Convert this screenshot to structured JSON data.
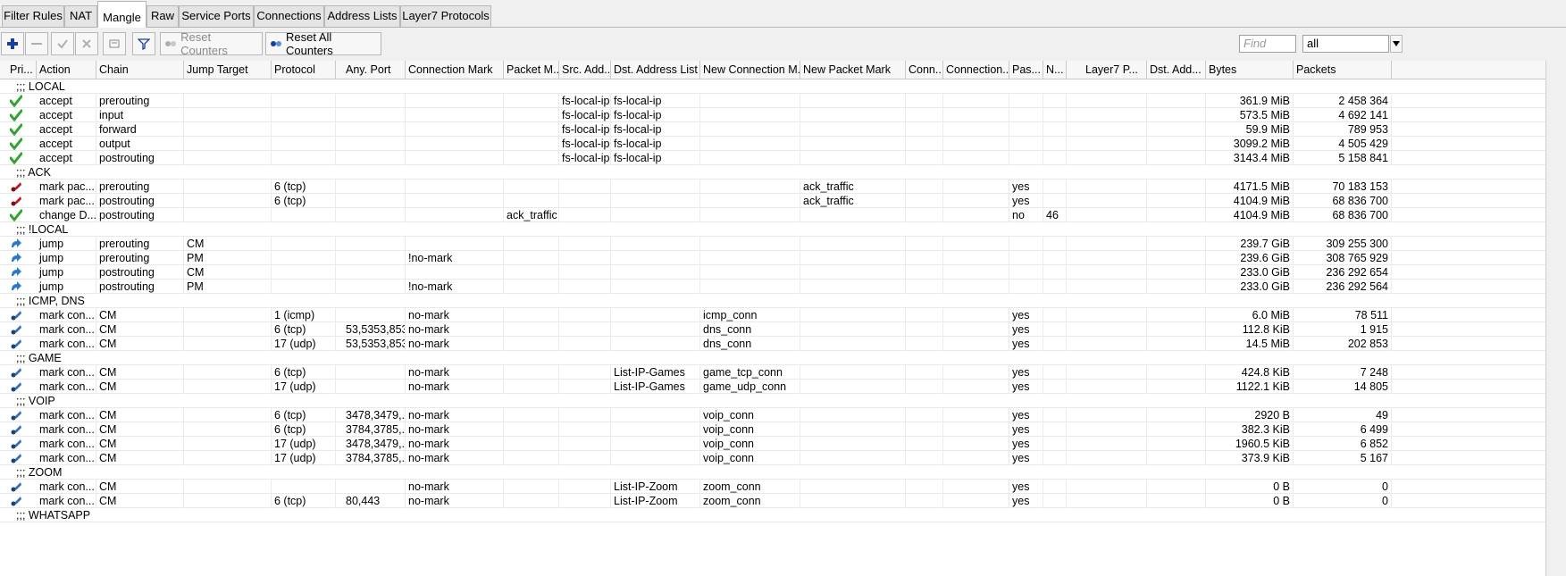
{
  "tabs": [
    "Filter Rules",
    "NAT",
    "Mangle",
    "Raw",
    "Service Ports",
    "Connections",
    "Address Lists",
    "Layer7 Protocols"
  ],
  "toolbar": {
    "reset_counters": "Reset Counters",
    "reset_all_counters": "Reset All Counters",
    "find_placeholder": "Find",
    "filter_value": "all"
  },
  "columns": [
    "Pri...",
    "Action",
    "Chain",
    "Jump Target",
    "Protocol",
    "Any. Port",
    "Connection Mark",
    "Packet M...",
    "Src. Add...",
    "Dst. Address List",
    "New Connection M...",
    "New Packet Mark",
    "Conn...",
    "Connection...",
    "Pas...",
    "N...",
    "Layer7 P...",
    "Dst. Add...",
    "Bytes",
    "Packets"
  ],
  "rows": [
    {
      "comment": ";;; LOCAL"
    },
    {
      "icon": "accept-icon",
      "action": "accept",
      "chain": "prerouting",
      "jump": "",
      "proto": "",
      "port": "",
      "cmark": "",
      "pmark": "",
      "src": "fs-local-ip",
      "dst": "fs-local-ip",
      "ncm": "",
      "npm": "",
      "pass": "",
      "n": "",
      "bytes": "361.9 MiB",
      "packets": "2 458 364"
    },
    {
      "icon": "accept-icon",
      "action": "accept",
      "chain": "input",
      "jump": "",
      "proto": "",
      "port": "",
      "cmark": "",
      "pmark": "",
      "src": "fs-local-ip",
      "dst": "fs-local-ip",
      "ncm": "",
      "npm": "",
      "pass": "",
      "n": "",
      "bytes": "573.5 MiB",
      "packets": "4 692 141"
    },
    {
      "icon": "accept-icon",
      "action": "accept",
      "chain": "forward",
      "jump": "",
      "proto": "",
      "port": "",
      "cmark": "",
      "pmark": "",
      "src": "fs-local-ip",
      "dst": "fs-local-ip",
      "ncm": "",
      "npm": "",
      "pass": "",
      "n": "",
      "bytes": "59.9 MiB",
      "packets": "789 953"
    },
    {
      "icon": "accept-icon",
      "action": "accept",
      "chain": "output",
      "jump": "",
      "proto": "",
      "port": "",
      "cmark": "",
      "pmark": "",
      "src": "fs-local-ip",
      "dst": "fs-local-ip",
      "ncm": "",
      "npm": "",
      "pass": "",
      "n": "",
      "bytes": "3099.2 MiB",
      "packets": "4 505 429"
    },
    {
      "icon": "accept-icon",
      "action": "accept",
      "chain": "postrouting",
      "jump": "",
      "proto": "",
      "port": "",
      "cmark": "",
      "pmark": "",
      "src": "fs-local-ip",
      "dst": "fs-local-ip",
      "ncm": "",
      "npm": "",
      "pass": "",
      "n": "",
      "bytes": "3143.4 MiB",
      "packets": "5 158 841"
    },
    {
      "comment": ";;; ACK"
    },
    {
      "icon": "mark-packet-icon",
      "action": "mark pac...",
      "chain": "prerouting",
      "jump": "",
      "proto": "6 (tcp)",
      "port": "",
      "cmark": "",
      "pmark": "",
      "src": "",
      "dst": "",
      "ncm": "",
      "npm": "ack_traffic",
      "pass": "yes",
      "n": "",
      "bytes": "4171.5 MiB",
      "packets": "70 183 153"
    },
    {
      "icon": "mark-packet-icon",
      "action": "mark pac...",
      "chain": "postrouting",
      "jump": "",
      "proto": "6 (tcp)",
      "port": "",
      "cmark": "",
      "pmark": "",
      "src": "",
      "dst": "",
      "ncm": "",
      "npm": "ack_traffic",
      "pass": "yes",
      "n": "",
      "bytes": "4104.9 MiB",
      "packets": "68 836 700"
    },
    {
      "icon": "accept-icon",
      "action": "change D...",
      "chain": "postrouting",
      "jump": "",
      "proto": "",
      "port": "",
      "cmark": "",
      "pmark": "ack_traffic",
      "src": "",
      "dst": "",
      "ncm": "",
      "npm": "",
      "pass": "no",
      "n": "46",
      "bytes": "4104.9 MiB",
      "packets": "68 836 700"
    },
    {
      "comment": ";;; !LOCAL"
    },
    {
      "icon": "jump-icon",
      "action": "jump",
      "chain": "prerouting",
      "jump": "CM",
      "proto": "",
      "port": "",
      "cmark": "",
      "pmark": "",
      "src": "",
      "dst": "",
      "ncm": "",
      "npm": "",
      "pass": "",
      "n": "",
      "bytes": "239.7 GiB",
      "packets": "309 255 300"
    },
    {
      "icon": "jump-icon",
      "action": "jump",
      "chain": "prerouting",
      "jump": "PM",
      "proto": "",
      "port": "",
      "cmark": "!no-mark",
      "pmark": "",
      "src": "",
      "dst": "",
      "ncm": "",
      "npm": "",
      "pass": "",
      "n": "",
      "bytes": "239.6 GiB",
      "packets": "308 765 929"
    },
    {
      "icon": "jump-icon",
      "action": "jump",
      "chain": "postrouting",
      "jump": "CM",
      "proto": "",
      "port": "",
      "cmark": "",
      "pmark": "",
      "src": "",
      "dst": "",
      "ncm": "",
      "npm": "",
      "pass": "",
      "n": "",
      "bytes": "233.0 GiB",
      "packets": "236 292 654"
    },
    {
      "icon": "jump-icon",
      "action": "jump",
      "chain": "postrouting",
      "jump": "PM",
      "proto": "",
      "port": "",
      "cmark": "!no-mark",
      "pmark": "",
      "src": "",
      "dst": "",
      "ncm": "",
      "npm": "",
      "pass": "",
      "n": "",
      "bytes": "233.0 GiB",
      "packets": "236 292 564"
    },
    {
      "comment": ";;; ICMP, DNS"
    },
    {
      "icon": "mark-connection-icon",
      "action": "mark con...",
      "chain": "CM",
      "jump": "",
      "proto": "1 (icmp)",
      "port": "",
      "cmark": "no-mark",
      "pmark": "",
      "src": "",
      "dst": "",
      "ncm": "icmp_conn",
      "npm": "",
      "pass": "yes",
      "n": "",
      "bytes": "6.0 MiB",
      "packets": "78 511"
    },
    {
      "icon": "mark-connection-icon",
      "action": "mark con...",
      "chain": "CM",
      "jump": "",
      "proto": "6 (tcp)",
      "port": "53,5353,853",
      "cmark": "no-mark",
      "pmark": "",
      "src": "",
      "dst": "",
      "ncm": "dns_conn",
      "npm": "",
      "pass": "yes",
      "n": "",
      "bytes": "112.8 KiB",
      "packets": "1 915"
    },
    {
      "icon": "mark-connection-icon",
      "action": "mark con...",
      "chain": "CM",
      "jump": "",
      "proto": "17 (udp)",
      "port": "53,5353,853",
      "cmark": "no-mark",
      "pmark": "",
      "src": "",
      "dst": "",
      "ncm": "dns_conn",
      "npm": "",
      "pass": "yes",
      "n": "",
      "bytes": "14.5 MiB",
      "packets": "202 853"
    },
    {
      "comment": ";;; GAME"
    },
    {
      "icon": "mark-connection-icon",
      "action": "mark con...",
      "chain": "CM",
      "jump": "",
      "proto": "6 (tcp)",
      "port": "",
      "cmark": "no-mark",
      "pmark": "",
      "src": "",
      "dst": "List-IP-Games",
      "ncm": "game_tcp_conn",
      "npm": "",
      "pass": "yes",
      "n": "",
      "bytes": "424.8 KiB",
      "packets": "7 248"
    },
    {
      "icon": "mark-connection-icon",
      "action": "mark con...",
      "chain": "CM",
      "jump": "",
      "proto": "17 (udp)",
      "port": "",
      "cmark": "no-mark",
      "pmark": "",
      "src": "",
      "dst": "List-IP-Games",
      "ncm": "game_udp_conn",
      "npm": "",
      "pass": "yes",
      "n": "",
      "bytes": "1122.1 KiB",
      "packets": "14 805"
    },
    {
      "comment": ";;; VOIP"
    },
    {
      "icon": "mark-connection-icon",
      "action": "mark con...",
      "chain": "CM",
      "jump": "",
      "proto": "6 (tcp)",
      "port": "3478,3479,...",
      "cmark": "no-mark",
      "pmark": "",
      "src": "",
      "dst": "",
      "ncm": "voip_conn",
      "npm": "",
      "pass": "yes",
      "n": "",
      "bytes": "2920 B",
      "packets": "49"
    },
    {
      "icon": "mark-connection-icon",
      "action": "mark con...",
      "chain": "CM",
      "jump": "",
      "proto": "6 (tcp)",
      "port": "3784,3785,...",
      "cmark": "no-mark",
      "pmark": "",
      "src": "",
      "dst": "",
      "ncm": "voip_conn",
      "npm": "",
      "pass": "yes",
      "n": "",
      "bytes": "382.3 KiB",
      "packets": "6 499"
    },
    {
      "icon": "mark-connection-icon",
      "action": "mark con...",
      "chain": "CM",
      "jump": "",
      "proto": "17 (udp)",
      "port": "3478,3479,...",
      "cmark": "no-mark",
      "pmark": "",
      "src": "",
      "dst": "",
      "ncm": "voip_conn",
      "npm": "",
      "pass": "yes",
      "n": "",
      "bytes": "1960.5 KiB",
      "packets": "6 852"
    },
    {
      "icon": "mark-connection-icon",
      "action": "mark con...",
      "chain": "CM",
      "jump": "",
      "proto": "17 (udp)",
      "port": "3784,3785,...",
      "cmark": "no-mark",
      "pmark": "",
      "src": "",
      "dst": "",
      "ncm": "voip_conn",
      "npm": "",
      "pass": "yes",
      "n": "",
      "bytes": "373.9 KiB",
      "packets": "5 167"
    },
    {
      "comment": ";;; ZOOM"
    },
    {
      "icon": "mark-connection-icon",
      "action": "mark con...",
      "chain": "CM",
      "jump": "",
      "proto": "",
      "port": "",
      "cmark": "no-mark",
      "pmark": "",
      "src": "",
      "dst": "List-IP-Zoom",
      "ncm": "zoom_conn",
      "npm": "",
      "pass": "yes",
      "n": "",
      "bytes": "0 B",
      "packets": "0"
    },
    {
      "icon": "mark-connection-icon",
      "action": "mark con...",
      "chain": "CM",
      "jump": "",
      "proto": "6 (tcp)",
      "port": "80,443",
      "cmark": "no-mark",
      "pmark": "",
      "src": "",
      "dst": "List-IP-Zoom",
      "ncm": "zoom_conn",
      "npm": "",
      "pass": "yes",
      "n": "",
      "bytes": "0 B",
      "packets": "0"
    },
    {
      "comment": ";;; WHATSAPP"
    }
  ]
}
